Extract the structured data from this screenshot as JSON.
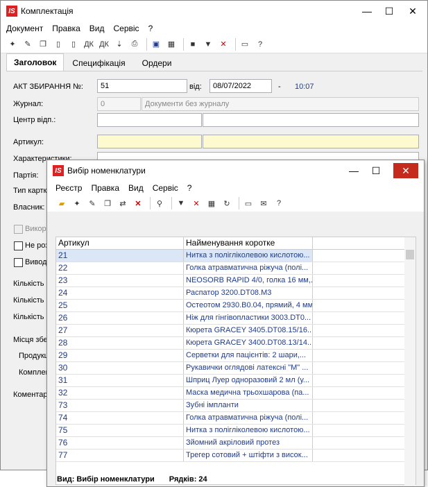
{
  "app_logo": "IS",
  "window": {
    "title": "Комплектація",
    "min": "—",
    "max": "☐",
    "close": "✕"
  },
  "menu": [
    "Документ",
    "Правка",
    "Вид",
    "Сервіс",
    "?"
  ],
  "tabs": [
    "Заголовок",
    "Специфікація",
    "Ордери"
  ],
  "form": {
    "act_label": "АКТ ЗБИРАННЯ №:",
    "act_value": "51",
    "from_label": "від:",
    "date": "08/07/2022",
    "dash": "-",
    "time": "10:07",
    "journal_label": "Журнал:",
    "journal_value": "0",
    "journal_name": "Документи без журналу",
    "center_label": "Центр відп.:",
    "article_label": "Артикул:",
    "char_label": "Характеристики:",
    "party_label": "Партія:",
    "cardtype_label": "Тип картк",
    "owner_label": "Власник:",
    "use_label": "Викори",
    "notdis_label": "Не роз",
    "output_label": "Виводи",
    "qty1_label": "Кількість",
    "qty2_label": "Кількість",
    "qty3_label": "Кількість",
    "place_label": "Місця збе",
    "product_label": "Продукц",
    "kit_label": "Комплек",
    "comment_label": "Коментар"
  },
  "dialog": {
    "title": "Вибір номенклатури",
    "min": "—",
    "max": "☐",
    "close": "✕",
    "menu": [
      "Реєстр",
      "Правка",
      "Вид",
      "Сервіс",
      "?"
    ],
    "headers": [
      "Артикул",
      "Найменування коротке"
    ],
    "rows": [
      [
        "21",
        "Нитка з полігліколевою кислотою..."
      ],
      [
        "22",
        "Голка атравматична ріжуча (полі..."
      ],
      [
        "23",
        "NEOSORB RAPID 4/0, голка 16 мм,..."
      ],
      [
        "24",
        "Распатор 3200.DT08.M3"
      ],
      [
        "25",
        "Остеотом 2930.B0.04, прямий, 4 мм"
      ],
      [
        "26",
        "Ніж для гінгівопластики 3003.DT0..."
      ],
      [
        "27",
        "Кюрета GRACEY 3405.DT08.15/16..."
      ],
      [
        "28",
        "Кюрета GRACEY 3400.DT08.13/14..."
      ],
      [
        "29",
        "Серветки для пацієнтів: 2 шари,..."
      ],
      [
        "30",
        "Рукавички оглядові латексні \"M\" ..."
      ],
      [
        "31",
        "Шприц Луер одноразовий 2 мл (у..."
      ],
      [
        "32",
        "Маска медична трьохшарова (па..."
      ],
      [
        "73",
        "Зубні імпланти"
      ],
      [
        "74",
        "Голка атравматична ріжуча (полі..."
      ],
      [
        "75",
        "Нитка з полігліколевою кислотою..."
      ],
      [
        "76",
        "Зйомний акріловий протез"
      ],
      [
        "77",
        "Трегер сотовий + штіфти з висок..."
      ]
    ],
    "status_view": "Вид: Вибір номенклатури",
    "status_rows": "Рядків: 24"
  }
}
